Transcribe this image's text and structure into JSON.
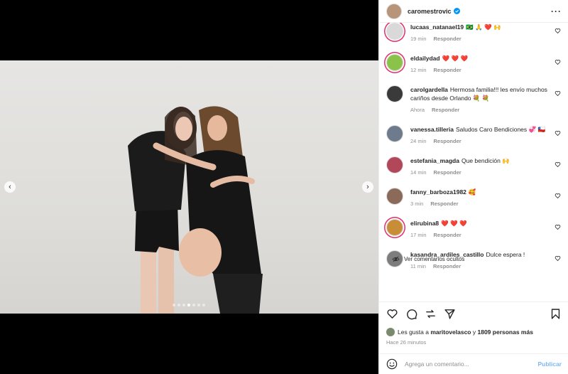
{
  "header": {
    "username": "caromestrovic",
    "verified_color": "#0095f6"
  },
  "comments": [
    {
      "user": "lucaas_natanael19",
      "text": "🇧🇷 🙏 ❤️ 🙌",
      "time": "19 min",
      "reply": "Responder",
      "avatar_color": "#d9d9d9",
      "ring": true
    },
    {
      "user": "eldailydad",
      "text": "❤️ ❤️ ❤️",
      "time": "12 min",
      "reply": "Responder",
      "avatar_color": "#8bc34a",
      "ring": true
    },
    {
      "user": "carolgardella",
      "text": "Hermosa familia!!! les envío muchos cariños desde Orlando 💐 💐",
      "time": "Ahora",
      "reply": "Responder",
      "avatar_color": "#3a3a3a",
      "ring": false
    },
    {
      "user": "vanessa.tilleria",
      "text": "Saludos Caro Bendiciones 💞 🇨🇱",
      "time": "24 min",
      "reply": "Responder",
      "avatar_color": "#6d7b8c",
      "ring": false
    },
    {
      "user": "estefania_magda",
      "text": "Que bendición 🙌",
      "time": "14 min",
      "reply": "Responder",
      "avatar_color": "#b3475a",
      "ring": false
    },
    {
      "user": "fanny_barboza1982",
      "text": "🥰",
      "time": "3 min",
      "reply": "Responder",
      "avatar_color": "#8c6a5a",
      "ring": false
    },
    {
      "user": "elirubina8",
      "text": "❤️ ❤️ ❤️",
      "time": "17 min",
      "reply": "Responder",
      "avatar_color": "#c98d3a",
      "ring": true
    },
    {
      "user": "kasandra_ardiles_castillo",
      "text": "Dulce espera !",
      "time": "11 min",
      "reply": "Responder",
      "avatar_color": "#7d7d7d",
      "ring": false
    }
  ],
  "hidden_comments": "Ver comentarios ocultos",
  "likes": {
    "prefix": "Les gusta a",
    "user": "maritovelasco",
    "middle": "y",
    "count": "1809 personas más"
  },
  "posted": "Hace 26 minutos",
  "add_comment": {
    "placeholder": "Agrega un comentario...",
    "publish": "Publicar"
  },
  "carousel": {
    "slides": 7,
    "active": 3
  },
  "icons": [
    "heart-icon",
    "comment-icon",
    "share-icon",
    "send-icon",
    "bookmark-icon",
    "emoji-icon",
    "more-icon",
    "chevron-left-icon",
    "chevron-right-icon",
    "eye-slash-icon"
  ]
}
